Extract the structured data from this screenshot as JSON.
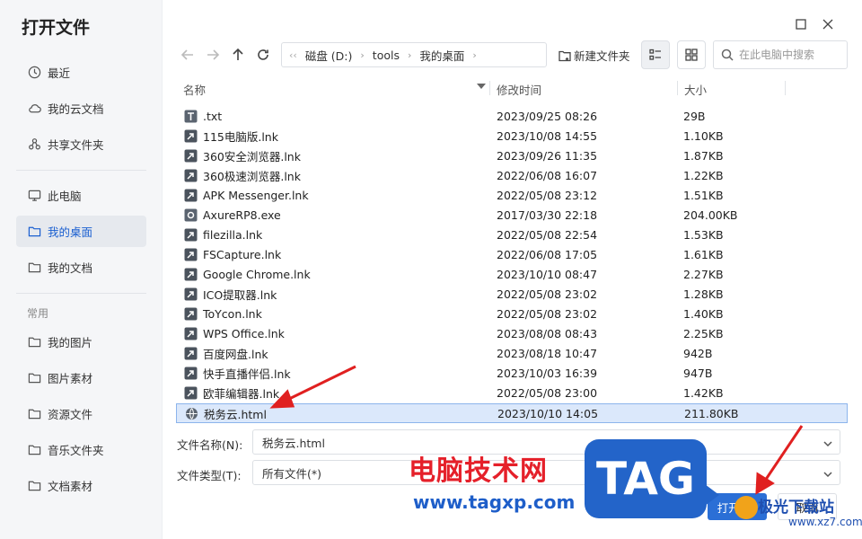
{
  "sidebar": {
    "title": "打开文件",
    "items": [
      {
        "label": "最近",
        "icon": "clock-icon"
      },
      {
        "label": "我的云文档",
        "icon": "cloud-icon"
      },
      {
        "label": "共享文件夹",
        "icon": "share-icon"
      },
      {
        "label": "此电脑",
        "icon": "monitor-icon"
      },
      {
        "label": "我的桌面",
        "icon": "folder-icon",
        "active": true
      },
      {
        "label": "我的文档",
        "icon": "folder-icon"
      }
    ],
    "section_label": "常用",
    "common": [
      {
        "label": "我的图片",
        "icon": "folder-icon"
      },
      {
        "label": "图片素材",
        "icon": "folder-icon"
      },
      {
        "label": "资源文件",
        "icon": "folder-icon"
      },
      {
        "label": "音乐文件夹",
        "icon": "folder-icon"
      },
      {
        "label": "文档素材",
        "icon": "folder-icon"
      }
    ]
  },
  "toolbar": {
    "breadcrumb": [
      "磁盘 (D:)",
      "tools",
      "我的桌面"
    ],
    "new_folder_label": "新建文件夹",
    "search_placeholder": "在此电脑中搜索"
  },
  "columns": {
    "name": "名称",
    "modified": "修改时间",
    "size": "大小"
  },
  "files": [
    {
      "name": ".txt",
      "date": "2023/09/25 08:26",
      "size": "29B",
      "type": "txt"
    },
    {
      "name": "115电脑版.lnk",
      "date": "2023/10/08 14:55",
      "size": "1.10KB",
      "type": "lnk"
    },
    {
      "name": "360安全浏览器.lnk",
      "date": "2023/09/26 11:35",
      "size": "1.87KB",
      "type": "lnk"
    },
    {
      "name": "360极速浏览器.lnk",
      "date": "2022/06/08 16:07",
      "size": "1.22KB",
      "type": "lnk"
    },
    {
      "name": "APK Messenger.lnk",
      "date": "2022/05/08 23:12",
      "size": "1.51KB",
      "type": "lnk"
    },
    {
      "name": "AxureRP8.exe",
      "date": "2017/03/30 22:18",
      "size": "204.00KB",
      "type": "exe"
    },
    {
      "name": "filezilla.lnk",
      "date": "2022/05/08 22:54",
      "size": "1.53KB",
      "type": "lnk"
    },
    {
      "name": "FSCapture.lnk",
      "date": "2022/06/08 17:05",
      "size": "1.61KB",
      "type": "lnk"
    },
    {
      "name": "Google Chrome.lnk",
      "date": "2023/10/10 08:47",
      "size": "2.27KB",
      "type": "lnk"
    },
    {
      "name": "ICO提取器.lnk",
      "date": "2022/05/08 23:02",
      "size": "1.28KB",
      "type": "lnk"
    },
    {
      "name": "ToYcon.lnk",
      "date": "2022/05/08 23:02",
      "size": "1.40KB",
      "type": "lnk"
    },
    {
      "name": "WPS Office.lnk",
      "date": "2023/08/08 08:43",
      "size": "2.25KB",
      "type": "lnk"
    },
    {
      "name": "百度网盘.lnk",
      "date": "2023/08/18 10:47",
      "size": "942B",
      "type": "lnk"
    },
    {
      "name": "快手直播伴侣.lnk",
      "date": "2023/10/03 16:39",
      "size": "947B",
      "type": "lnk"
    },
    {
      "name": "欧菲编辑器.lnk",
      "date": "2022/05/08 23:00",
      "size": "1.42KB",
      "type": "lnk"
    },
    {
      "name": "税务云.html",
      "date": "2023/10/10 14:05",
      "size": "211.80KB",
      "type": "html",
      "selected": true
    }
  ],
  "form": {
    "filename_label": "文件名称(N):",
    "filename_value": "税务云.html",
    "filetype_label": "文件类型(T):",
    "filetype_value": "所有文件(*)"
  },
  "buttons": {
    "open": "打开(O)",
    "cancel": "取消"
  },
  "watermark": {
    "title": "电脑技术网",
    "url": "www.tagxp.com",
    "tag": "TAG",
    "site_cn": "极光下载站",
    "site_en": "www.xz7.com"
  },
  "colors": {
    "accent": "#2b6fd6",
    "selected_row": "#dbe8fb",
    "arrow": "#e02020"
  }
}
